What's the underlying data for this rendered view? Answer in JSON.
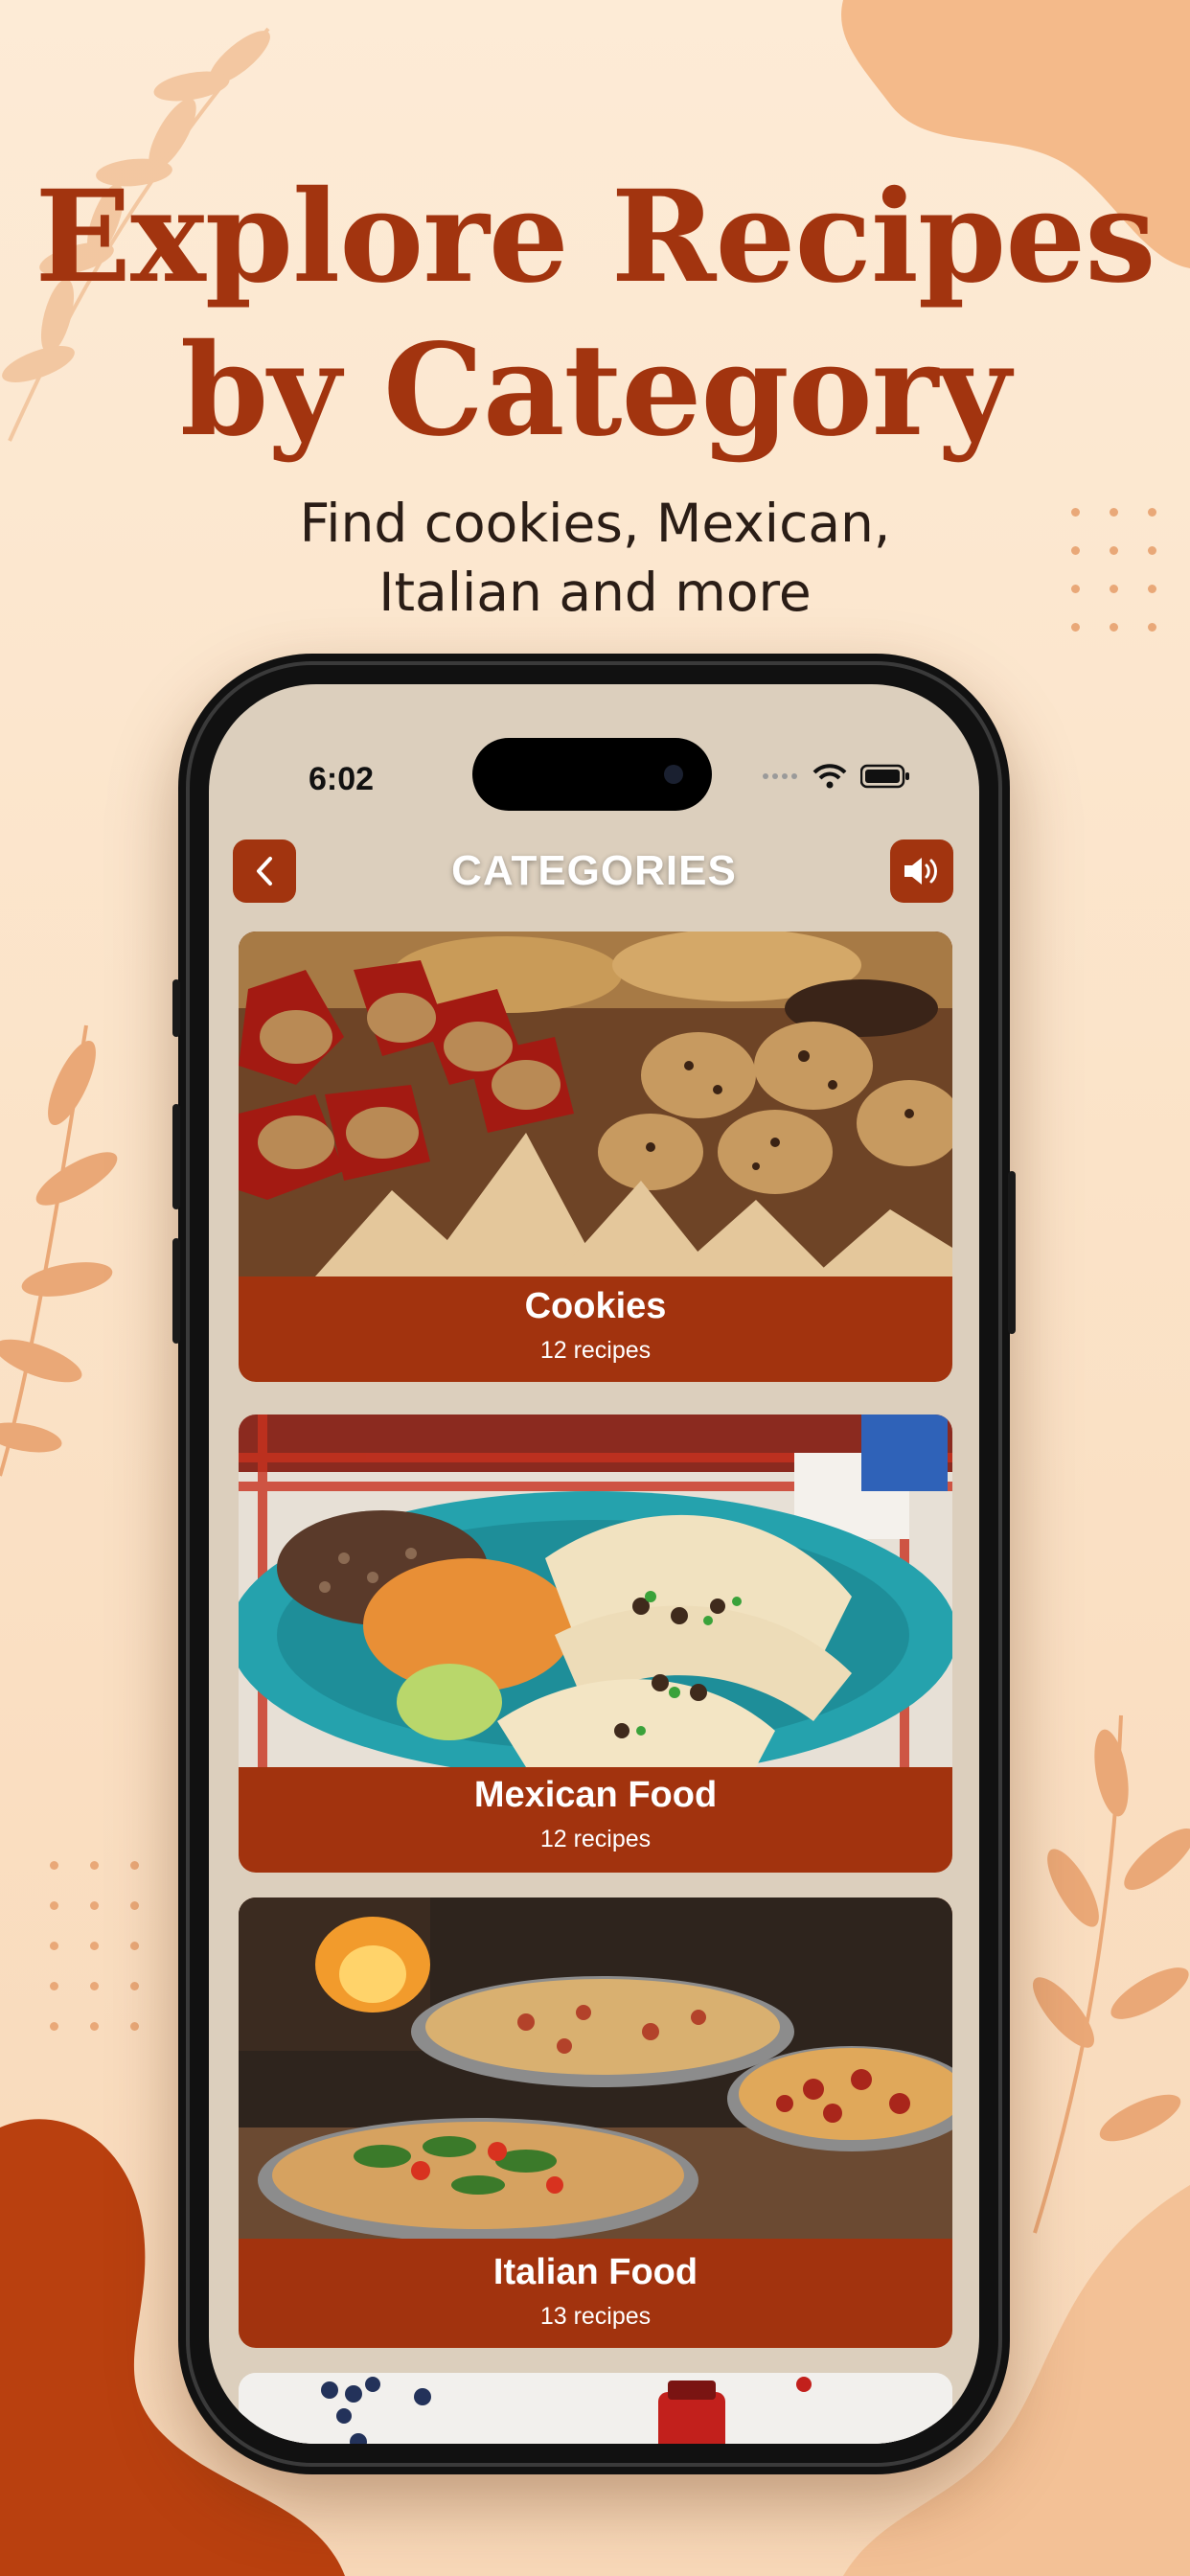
{
  "promo": {
    "headline_line1": "Explore Recipes",
    "headline_line2": "by Category",
    "subline_line1": "Find cookies, Mexican,",
    "subline_line2": "Italian and more"
  },
  "status_bar": {
    "time": "6:02",
    "icons": [
      "signal-icon",
      "wifi-icon",
      "battery-icon"
    ]
  },
  "nav": {
    "title": "CATEGORIES",
    "back_icon": "chevron-left-icon",
    "sound_icon": "speaker-icon"
  },
  "categories": [
    {
      "name": "Cookies",
      "count": "12 recipes"
    },
    {
      "name": "Mexican Food",
      "count": "12 recipes"
    },
    {
      "name": "Italian Food",
      "count": "13 recipes"
    }
  ],
  "colors": {
    "accent": "#a2340f",
    "background": "#fbe6cf",
    "screen_background": "#dccfbd"
  }
}
